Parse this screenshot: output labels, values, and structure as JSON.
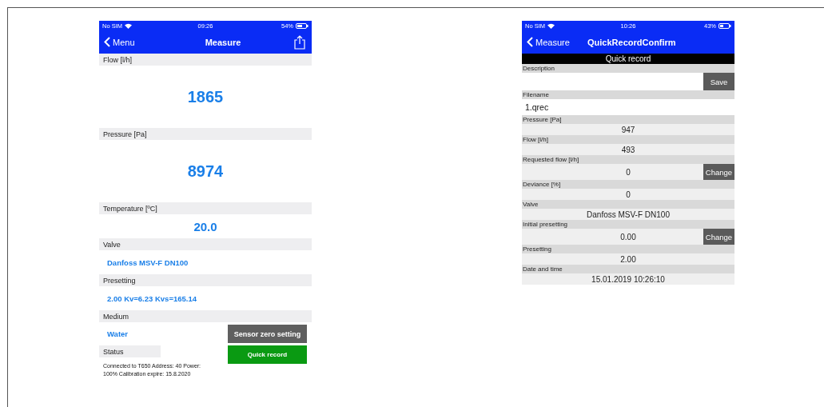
{
  "screens": [
    {
      "status_bar": {
        "carrier": "No SIM",
        "time": "09:26",
        "battery": "54%"
      },
      "nav": {
        "back": "Menu",
        "title": "Measure"
      },
      "sections": [
        {
          "kind": "big",
          "label": "Flow [l/h]",
          "value": "1865"
        },
        {
          "kind": "big",
          "label": "Pressure [Pa]",
          "value": "8974"
        },
        {
          "kind": "medium",
          "label": "Temperature [ºC]",
          "value": "20.0"
        },
        {
          "kind": "text",
          "label": "Valve",
          "value": "Danfoss MSV-F  DN100"
        },
        {
          "kind": "text",
          "label": "Presetting",
          "value": "2.00 Kv=6.23 Kvs=165.14"
        }
      ],
      "medium": {
        "label": "Medium",
        "value": "Water",
        "button": "Sensor zero setting"
      },
      "status": {
        "label": "Status",
        "text": "Connected to T650 Address: 40 Power: 100% Calibration expire: 15.8.2020",
        "button": "Quick record"
      }
    },
    {
      "status_bar": {
        "carrier": "No SIM",
        "time": "10:26",
        "battery": "43%"
      },
      "nav": {
        "back": "Measure",
        "title": "QuickRecordConfirm"
      },
      "banner": "Quick record",
      "fields": [
        {
          "kind": "input",
          "label": "Description",
          "button": "Save"
        },
        {
          "kind": "filename",
          "label": "Filename",
          "value": "1.qrec"
        },
        {
          "kind": "value",
          "label": "Pressure [Pa]",
          "value": "947"
        },
        {
          "kind": "value",
          "label": "Flow [l/h]",
          "value": "493"
        },
        {
          "kind": "button",
          "label": "Requested flow [l/h]",
          "value": "0",
          "button": "Change"
        },
        {
          "kind": "value",
          "label": "Deviance [%]",
          "value": "0"
        },
        {
          "kind": "value",
          "label": "Valve",
          "value": "Danfoss MSV-F  DN100"
        },
        {
          "kind": "button",
          "label": "Initial presetting",
          "value": "0.00",
          "button": "Change"
        },
        {
          "kind": "value",
          "label": "Presetting",
          "value": "2.00"
        },
        {
          "kind": "value",
          "label": "Date and time",
          "value": "15.01.2019 10:26:10"
        }
      ]
    }
  ]
}
